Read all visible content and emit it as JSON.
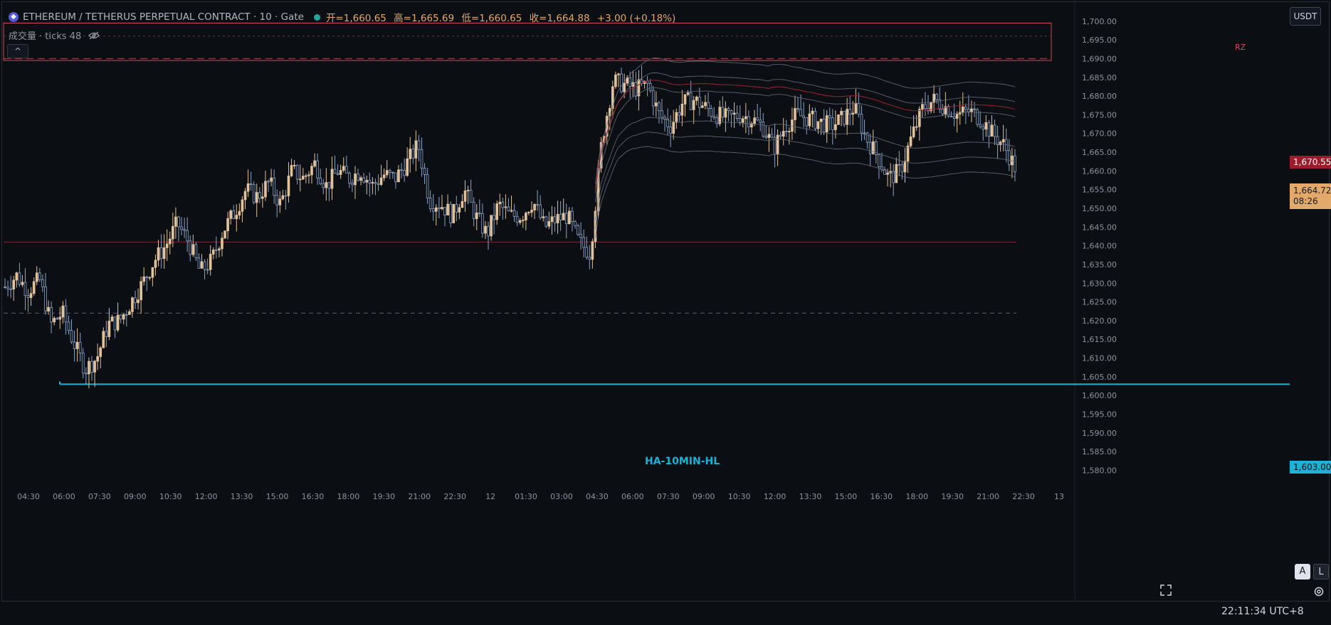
{
  "header": {
    "symbol": "ETHEREUM / TETHERUS PERPETUAL CONTRACT",
    "interval": "10",
    "exchange": "Gate",
    "open": "开=1,660.65",
    "high": "高=1,665.69",
    "low": "低=1,660.65",
    "close": "收=1,664.88",
    "change": "+3.00 (+0.18%)"
  },
  "volume_label": "成交量 · ticks 48",
  "currency_button": "USDT",
  "price_tags": {
    "red_level": "1,670.55",
    "current_price": "1,664.72",
    "countdown": "08:26",
    "hl_level": "1,603.00"
  },
  "annotations": {
    "rz": "RZ",
    "hl_line": "HA-10MIN-HL"
  },
  "buttons": {
    "auto": "A",
    "log": "L"
  },
  "clock": "22:11:34 UTC+8",
  "colors": {
    "background": "#0b0e13",
    "candle_up": "#e2c29b",
    "candle_down": "#8aa4c8",
    "resistance_box": "#d6485b",
    "hl_line": "#1ab3d6",
    "vwap_mid": "#9b2330",
    "bands": "#6b7280"
  },
  "chart_data": {
    "type": "candlestick",
    "y_axis_ticks": [
      1700,
      1695,
      1690,
      1685,
      1680,
      1675,
      1670,
      1665,
      1660,
      1655,
      1650,
      1645,
      1640,
      1635,
      1630,
      1625,
      1620,
      1615,
      1610,
      1605,
      1600,
      1595,
      1590,
      1585,
      1580
    ],
    "ylim": [
      1578,
      1703
    ],
    "x_tick_labels": [
      "04:30",
      "06:00",
      "07:30",
      "09:00",
      "10:30",
      "12:00",
      "13:30",
      "15:00",
      "16:30",
      "18:00",
      "19:30",
      "21:00",
      "22:30",
      "12",
      "01:30",
      "03:00",
      "04:30",
      "06:00",
      "07:30",
      "09:00",
      "10:30",
      "12:00",
      "13:30",
      "15:00",
      "16:30",
      "18:00",
      "19:30",
      "21:00",
      "22:30",
      "13"
    ],
    "trajectory": [
      1629,
      1632,
      1628,
      1631,
      1619,
      1622,
      1614,
      1607,
      1610,
      1619,
      1620,
      1625,
      1630,
      1636,
      1640,
      1646,
      1641,
      1633,
      1636,
      1644,
      1649,
      1655,
      1653,
      1657,
      1651,
      1660,
      1658,
      1662,
      1656,
      1660,
      1658,
      1660,
      1656,
      1659,
      1658,
      1662,
      1667,
      1652,
      1651,
      1648,
      1655,
      1648,
      1643,
      1651,
      1648,
      1648,
      1652,
      1645,
      1647,
      1648,
      1641,
      1638,
      1668,
      1684,
      1683,
      1682,
      1683,
      1675,
      1672,
      1678,
      1679,
      1677,
      1675,
      1674,
      1675,
      1674,
      1672,
      1666,
      1672,
      1675,
      1674,
      1673,
      1672,
      1674,
      1677,
      1669,
      1664,
      1658,
      1660,
      1669,
      1677,
      1679,
      1677,
      1675,
      1676,
      1674,
      1670,
      1667,
      1661
    ],
    "horizontal_levels": {
      "resistance_zone": [
        1689.5,
        1699.5
      ],
      "red_line_upper": 1690,
      "red_line_lower": 1641,
      "dashed_line": 1622,
      "hl_line": 1603
    }
  }
}
